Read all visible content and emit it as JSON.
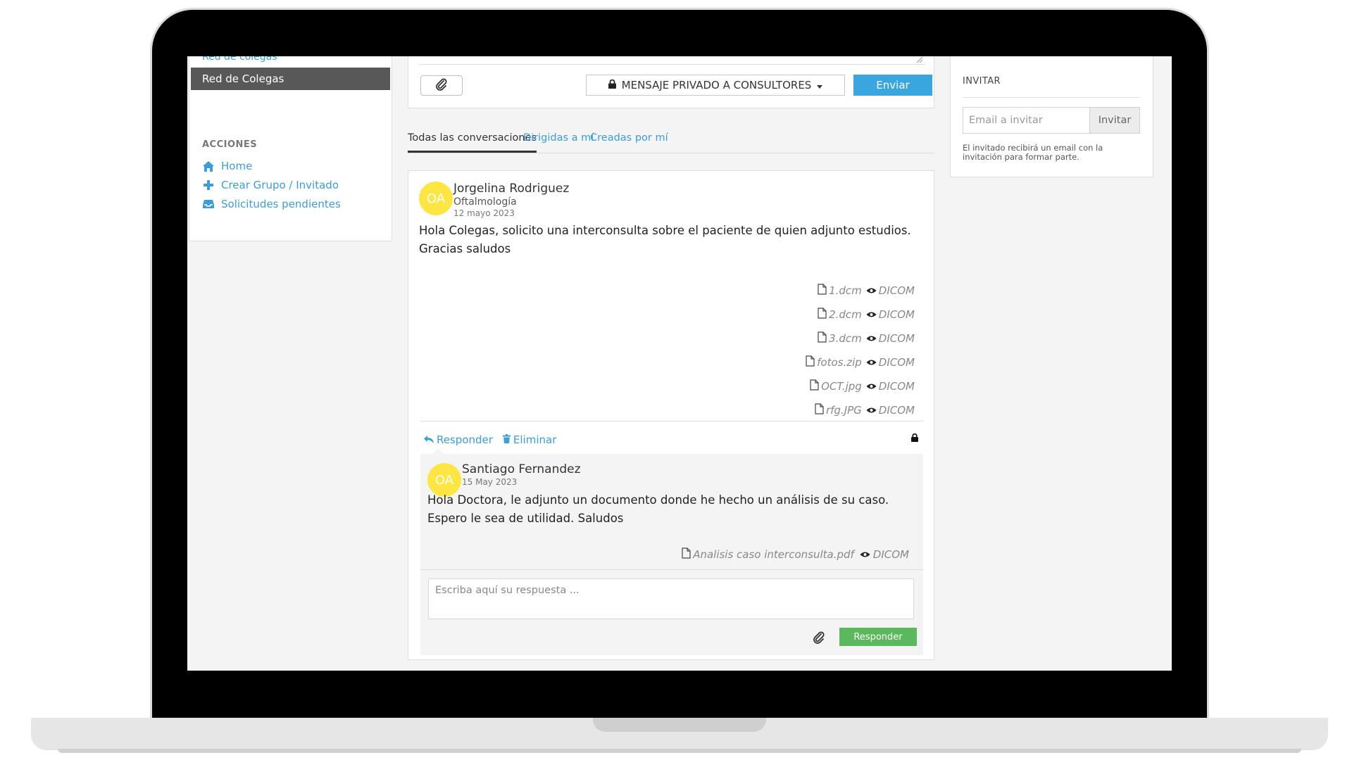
{
  "sidebar": {
    "link_top": "Red de colegas",
    "active_item": "Red de Colegas",
    "actions_title": "ACCIONES",
    "items": [
      {
        "label": "Home",
        "icon": "home-icon"
      },
      {
        "label": "Crear Grupo / Invitado",
        "icon": "plus-icon"
      },
      {
        "label": "Solicitudes pendientes",
        "icon": "inbox-icon"
      }
    ]
  },
  "compose": {
    "privacy_label": "MENSAJE PRIVADO A CONSULTORES",
    "send_label": "Enviar"
  },
  "tabs": [
    {
      "label": "Todas las conversaciones"
    },
    {
      "label": "Dirigidas a mí"
    },
    {
      "label": "Creadas por mí"
    }
  ],
  "post": {
    "avatar_initials": "OA",
    "author": "Jorgelina Rodriguez",
    "specialty": "Oftalmología",
    "date": "12 mayo 2023",
    "body": "Hola Colegas, solicito una interconsulta sobre el paciente de quien adjunto estudios. Gracias saludos",
    "attachments": [
      {
        "file": "1.dcm",
        "viewer": "DICOM"
      },
      {
        "file": "2.dcm",
        "viewer": "DICOM"
      },
      {
        "file": "3.dcm",
        "viewer": "DICOM"
      },
      {
        "file": "fotos.zip",
        "viewer": "DICOM"
      },
      {
        "file": "OCT.jpg",
        "viewer": "DICOM"
      },
      {
        "file": "rfg.JPG",
        "viewer": "DICOM"
      }
    ],
    "reply_action": "Responder",
    "delete_action": "Eliminar"
  },
  "reply": {
    "avatar_initials": "OA",
    "author": "Santiago Fernandez",
    "date": "15 May 2023",
    "body": "Hola Doctora, le adjunto un documento donde he hecho un análisis de su caso. Espero le sea de utilidad. Saludos",
    "attachment_file": "Analisis caso interconsulta.pdf",
    "attachment_viewer": "DICOM",
    "textarea_placeholder": "Escriba aquí su respuesta ...",
    "send_label": "Responder"
  },
  "invite": {
    "title": "INVITAR",
    "email_placeholder": "Email a invitar",
    "button_label": "Invitar",
    "note": "El invitado recibirá un email con la invitación para formar parte."
  },
  "colors": {
    "accent": "#3a9ed8",
    "send_button": "#3aa6e0",
    "reply_button": "#5cb85c",
    "avatar": "#fde641",
    "sidebar_active": "#585858"
  }
}
